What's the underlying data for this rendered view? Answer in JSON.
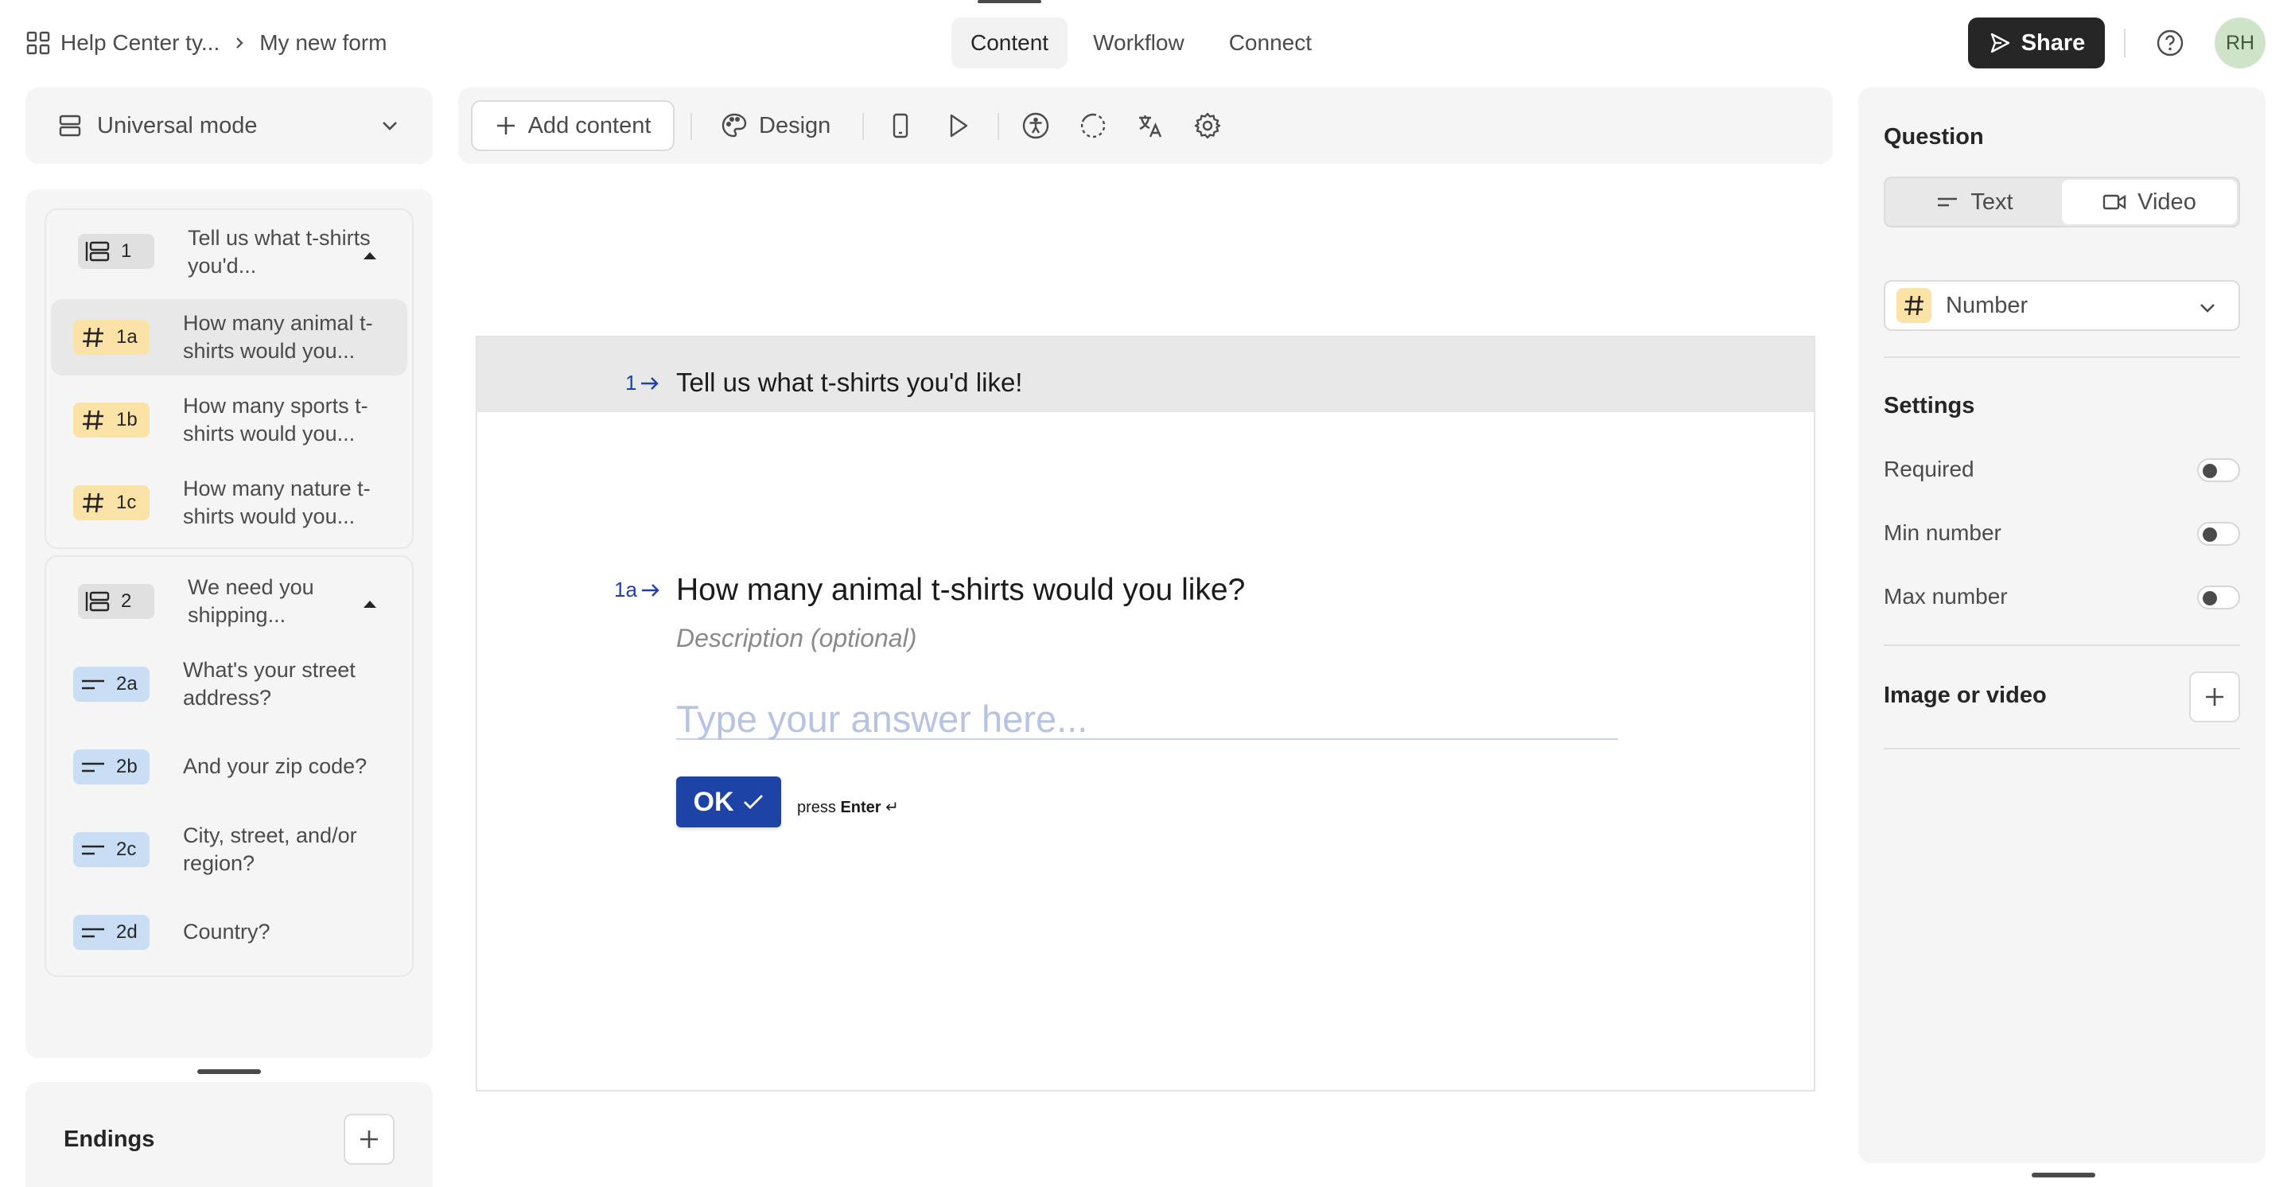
{
  "header": {
    "breadcrumb_workspace": "Help Center ty...",
    "breadcrumb_form": "My new form",
    "tabs": [
      "Content",
      "Workflow",
      "Connect"
    ],
    "share_label": "Share",
    "avatar_initials": "RH"
  },
  "sidebar": {
    "mode_label": "Universal mode",
    "groups": [
      {
        "badge": "1",
        "label": "Tell us what t-shirts you'd...",
        "items": [
          {
            "badge": "1a",
            "label": "How many animal t-shirts would you...",
            "type": "number"
          },
          {
            "badge": "1b",
            "label": "How many sports t-shirts would you...",
            "type": "number"
          },
          {
            "badge": "1c",
            "label": "How many nature t-shirts would you...",
            "type": "number"
          }
        ]
      },
      {
        "badge": "2",
        "label": "We need you shipping...",
        "items": [
          {
            "badge": "2a",
            "label": "What's your street address?",
            "type": "text"
          },
          {
            "badge": "2b",
            "label": "And your zip code?",
            "type": "text"
          },
          {
            "badge": "2c",
            "label": "City, street, and/or region?",
            "type": "text"
          },
          {
            "badge": "2d",
            "label": "Country?",
            "type": "text"
          }
        ]
      }
    ],
    "endings_label": "Endings"
  },
  "toolbar": {
    "add_content_label": "Add content",
    "design_label": "Design"
  },
  "canvas": {
    "group_number": "1",
    "group_title": "Tell us what t-shirts you'd like!",
    "question_number": "1a",
    "question_title": "How many animal t-shirts would you like?",
    "description_placeholder": "Description (optional)",
    "answer_placeholder": "Type your answer here...",
    "ok_label": "OK",
    "press_label": "press",
    "enter_label": "Enter"
  },
  "right_panel": {
    "question_heading": "Question",
    "segment_text": "Text",
    "segment_video": "Video",
    "question_type": "Number",
    "settings_heading": "Settings",
    "settings": [
      {
        "label": "Required",
        "enabled": false
      },
      {
        "label": "Min number",
        "enabled": false
      },
      {
        "label": "Max number",
        "enabled": false
      }
    ],
    "media_heading": "Image or video"
  },
  "colors": {
    "accent": "#1e43a7",
    "number_badge": "#fbe3a8",
    "text_badge": "#c9def5",
    "group_badge": "#e0e0e0",
    "share_button": "#262627"
  }
}
